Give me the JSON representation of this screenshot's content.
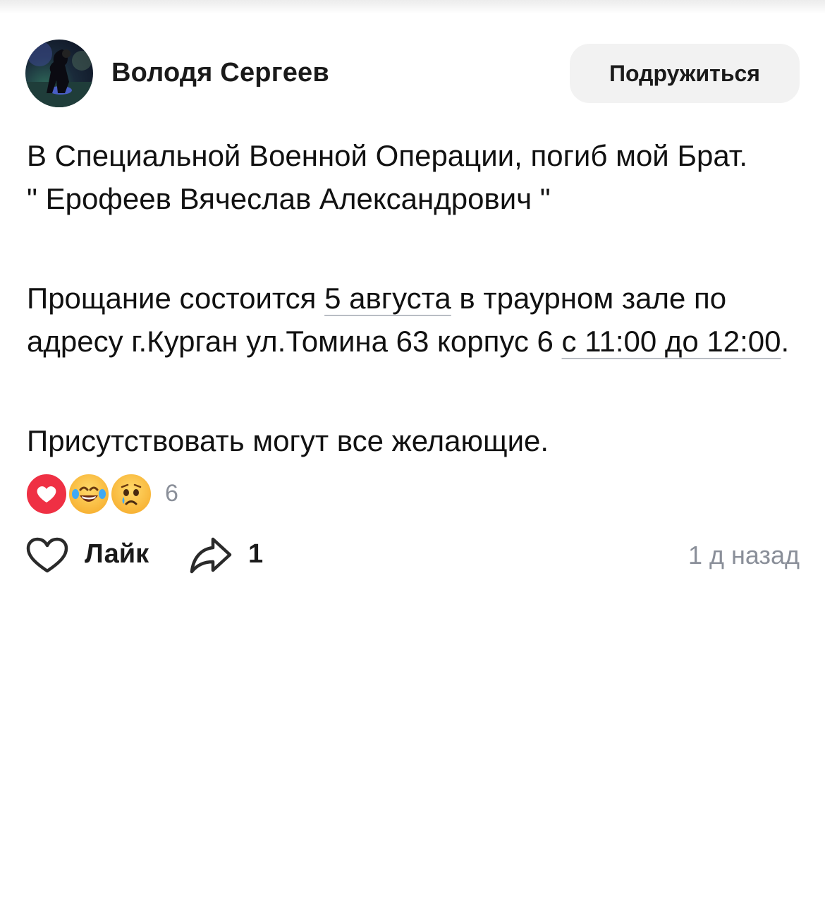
{
  "author": {
    "name": "Володя Сергеев",
    "avatar": "avatar-photo"
  },
  "friend_button": {
    "label": "Подружиться"
  },
  "post": {
    "p1_line1": "В Специальной Военной Операции, погиб мой Брат.",
    "p1_line2": "\" Ерофеев Вячеслав Александрович \"",
    "p2_part1": "Прощание состоится ",
    "p2_date": "5 августа",
    "p2_part2": " в траурном зале по адресу г.Курган ул.Томина 63 корпус 6 ",
    "p2_time": "с 11:00 до 12:00",
    "p2_part3": ".",
    "p3": "Присутствовать могут все желающие."
  },
  "reactions": {
    "icons": [
      "heart-icon",
      "laughing-tears-icon",
      "crying-face-icon"
    ],
    "count": "6"
  },
  "actions": {
    "like_label": "Лайк",
    "share_count": "1",
    "timestamp": "1 д назад"
  },
  "colors": {
    "heart_reaction": "#ef3044",
    "muted_text": "#8a8f99",
    "button_bg": "#f2f2f2"
  }
}
